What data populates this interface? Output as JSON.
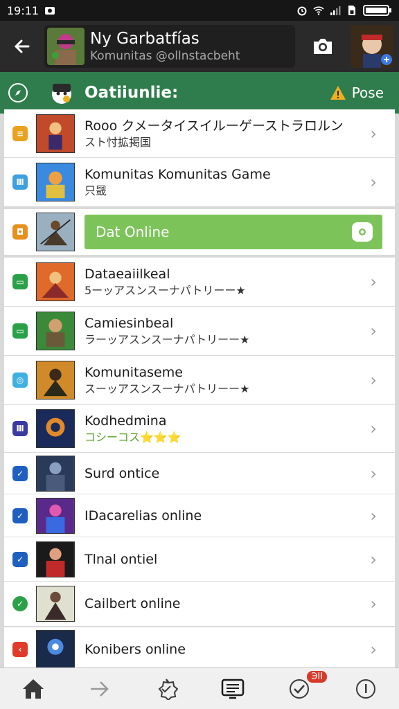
{
  "status": {
    "time": "19:11",
    "icons": [
      "camera-notify-icon",
      "alarm-icon",
      "wifi-icon",
      "signal-icon",
      "sim-icon",
      "battery-icon"
    ]
  },
  "header": {
    "title": "Ny Garbatfías",
    "subtitle": "Komunitas @ollnstacbeht",
    "icons": [
      "back-arrow-icon",
      "camera-icon"
    ]
  },
  "bar": {
    "title": "Oatiiunlie:",
    "action_label": "Pose",
    "icons": [
      "compass-icon",
      "warning-icon"
    ],
    "color": "#2f7d4c"
  },
  "card1": [
    {
      "title": "Rooo クメータイスイルーゲーストラロルン",
      "subtitle": "スト忖拡掲国",
      "lead_color": "#e8a21e",
      "lead_glyph": "≡"
    },
    {
      "title": "Komunitas Komunitas Game",
      "subtitle": "只䍞",
      "lead_color": "#3fa0e0",
      "lead_glyph": "Ⅲ"
    }
  ],
  "card2": {
    "button_label": "Dat Online",
    "lead_color": "#e8901e",
    "button_color": "#7cc45a"
  },
  "card3": [
    {
      "title": "Dataeaiilkeal",
      "subtitle": "5ーッアスンスーナパトリーー★",
      "lead_color": "#2aa148",
      "lead_glyph": "▭",
      "stars": false
    },
    {
      "title": "Camiesinbeal",
      "subtitle": "ラーッアスンスーナパトリーー★",
      "lead_color": "#2aa148",
      "lead_glyph": "▭",
      "stars": false
    },
    {
      "title": "Komunitaseme",
      "subtitle": "スーッアスンスーナパトリーー★",
      "lead_color": "#3fb0e0",
      "lead_glyph": "◎",
      "stars": false
    },
    {
      "title": "Kodhedmina",
      "subtitle": "コシーコス⭐⭐⭐",
      "lead_color": "#3a3aa0",
      "lead_glyph": "Ⅲ",
      "stars": true
    },
    {
      "title": "Surd ontice",
      "subtitle": "",
      "lead_color": "#1f5fbf",
      "lead_glyph": "✓",
      "stars": false
    },
    {
      "title": "IDacarelias online",
      "subtitle": "",
      "lead_color": "#1f5fbf",
      "lead_glyph": "✓",
      "stars": false
    },
    {
      "title": "Tlnal ontiel",
      "subtitle": "",
      "lead_color": "#1f5fbf",
      "lead_glyph": "✓",
      "stars": false
    },
    {
      "title": "Cailbert online",
      "subtitle": "",
      "lead_color": "#2aa148",
      "lead_glyph": "✓",
      "stars": false
    }
  ],
  "card4": [
    {
      "title": "Konibers online",
      "subtitle": "",
      "lead_color": "#e03a2a",
      "lead_glyph": "‹"
    }
  ],
  "nav": {
    "items": [
      "home-icon",
      "forward-icon",
      "badge-icon",
      "feed-icon",
      "check-icon",
      "info-icon"
    ],
    "badge": "ЭII"
  }
}
